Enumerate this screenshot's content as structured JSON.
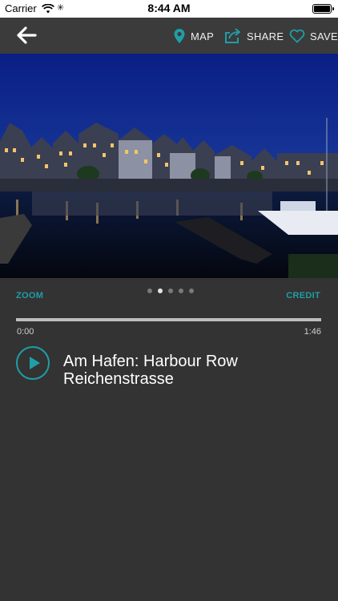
{
  "status": {
    "carrier": "Carrier",
    "time": "8:44 AM"
  },
  "nav": {
    "map_label": "MAP",
    "share_label": "SHARE",
    "save_label": "SAVE"
  },
  "gallery": {
    "zoom_label": "ZOOM",
    "credit_label": "CREDIT",
    "dot_count": 5,
    "active_dot": 1
  },
  "audio": {
    "start_time": "0:00",
    "end_time": "1:46",
    "progress": 0
  },
  "stop": {
    "title_line1": "Am Hafen: Harbour Row",
    "title_line2": "Reichenstrasse"
  },
  "colors": {
    "accent": "#1f9ea6",
    "background": "#333333",
    "navbar": "#3b3b3b"
  }
}
